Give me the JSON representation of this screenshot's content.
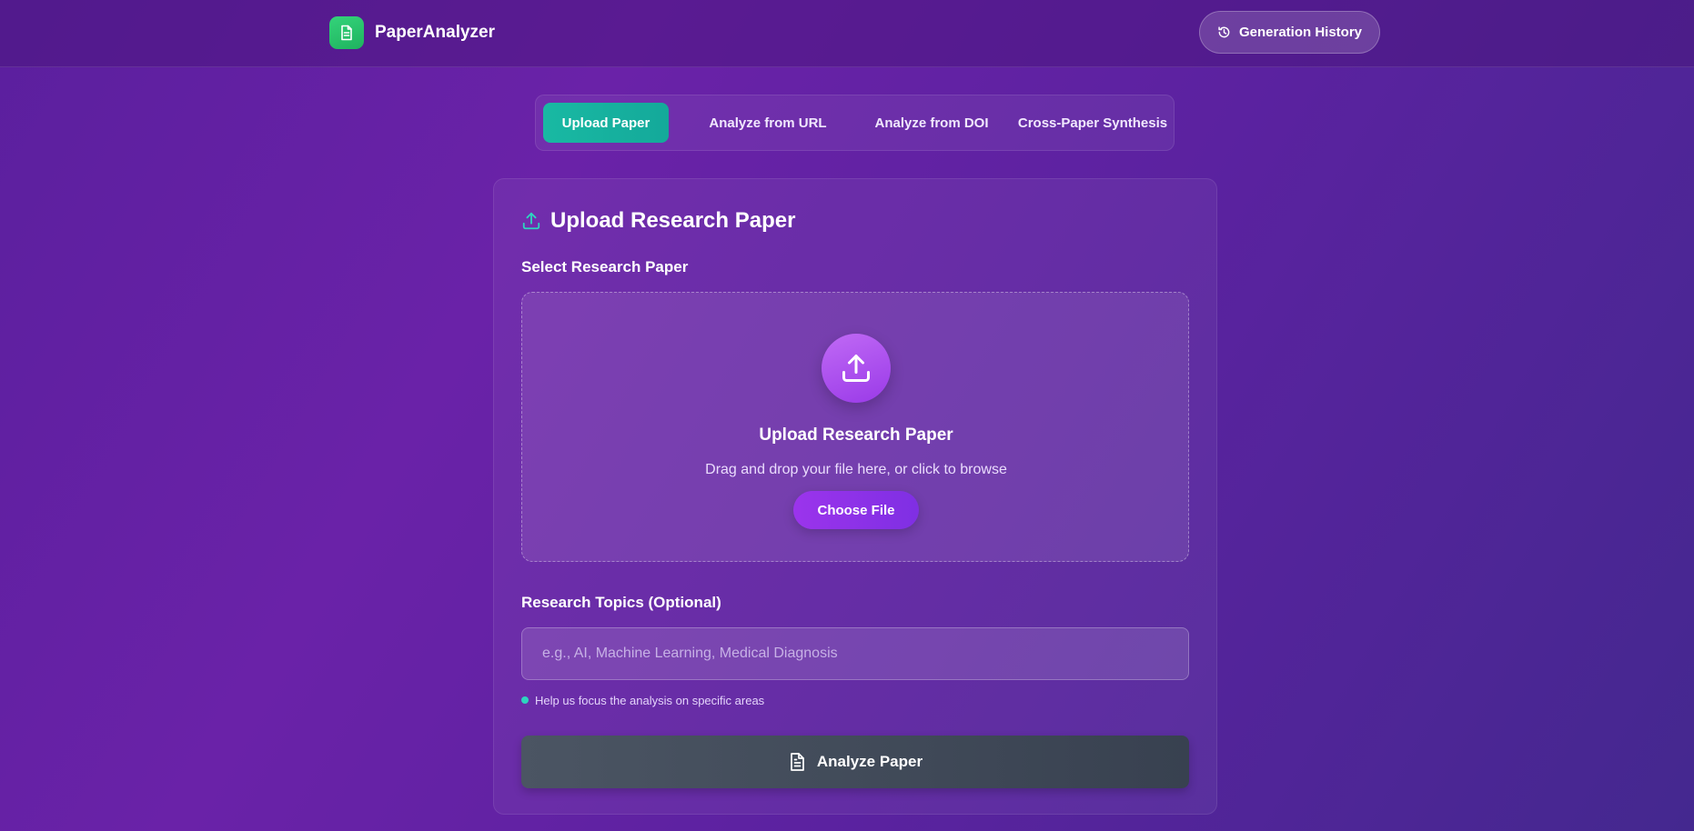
{
  "header": {
    "brand_name": "PaperAnalyzer",
    "logo_icon": "document-icon",
    "history_label": "Generation History",
    "history_icon": "history-icon"
  },
  "tabs": [
    {
      "label": "Upload Paper",
      "active": true
    },
    {
      "label": "Analyze from URL",
      "active": false
    },
    {
      "label": "Analyze from DOI",
      "active": false
    },
    {
      "label": "Cross-Paper Synthesis",
      "active": false
    }
  ],
  "card": {
    "title": "Upload Research Paper",
    "title_icon": "upload-icon",
    "select_label": "Select Research Paper",
    "dropzone": {
      "icon": "upload-icon",
      "title": "Upload Research Paper",
      "subtitle": "Drag and drop your file here, or click to browse",
      "button_label": "Choose File"
    },
    "topics_label": "Research Topics (Optional)",
    "topics_placeholder": "e.g., AI, Machine Learning, Medical Diagnosis",
    "topics_value": "",
    "hint": "Help us focus the analysis on specific areas",
    "analyze_label": "Analyze Paper",
    "analyze_icon": "document-icon"
  },
  "colors": {
    "accent_teal": "#19b9a3",
    "brand_green": "#2fc86e",
    "button_purple": "#8b32e8",
    "analyze_gray": "#434c5a"
  }
}
